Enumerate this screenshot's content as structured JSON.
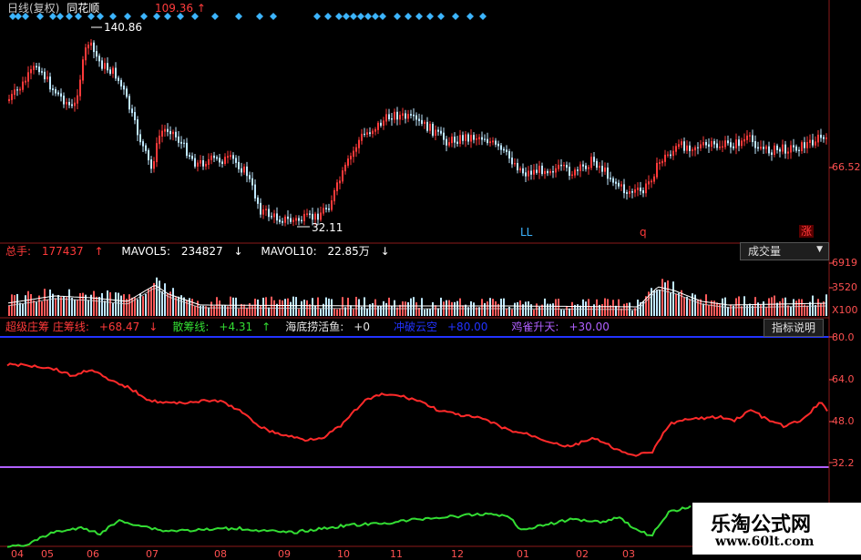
{
  "header": {
    "title": "日线(复权)",
    "stock_name": "同花顺",
    "price_marker": "109.36",
    "price_arrow": "↑"
  },
  "price_chart": {
    "high_label": "140.86",
    "low_label": "32.11",
    "axis_price": "66.52",
    "signal_marks": [
      "LL",
      "q",
      "涨"
    ],
    "colors": {
      "up": "#ff3a3a",
      "down": "#bfe8ff",
      "marker": "#3cb4ff"
    }
  },
  "volume_panel": {
    "total_label": "总手:",
    "total_value": "177437",
    "total_arrow": "↑",
    "mavol5_label": "MAVOL5:",
    "mavol5_value": "234827",
    "mavol5_arrow": "↓",
    "mavol10_label": "MAVOL10:",
    "mavol10_value": "22.85万",
    "mavol10_arrow": "↓",
    "selector_label": "成交量",
    "axis_labels": [
      "6919",
      "3520",
      "X100"
    ]
  },
  "indicator_panel": {
    "items": [
      {
        "name": "超级庄筹 庄筹线:",
        "value": "+68.47",
        "arrow": "↓",
        "color": "#ff3a3a"
      },
      {
        "name": "散筹线:",
        "value": "+4.31",
        "arrow": "↑",
        "color": "#33dd33"
      },
      {
        "name": "海底捞活鱼:",
        "value": "+0",
        "arrow": "",
        "color": "#e6e6e6"
      },
      {
        "name": "冲破云空",
        "value": "+80.00",
        "arrow": "",
        "color": "#2233ff"
      },
      {
        "name": "鸡雀升天:",
        "value": "+30.00",
        "arrow": "",
        "color": "#b060ff"
      }
    ],
    "explain_button": "指标说明",
    "axis_labels": [
      "80.0",
      "64.0",
      "48.0",
      "32.2"
    ]
  },
  "x_axis": {
    "labels": [
      "04",
      "05",
      "06",
      "07",
      "08",
      "09",
      "10",
      "11",
      "12",
      "01",
      "02",
      "03"
    ]
  },
  "watermark": {
    "brand": "乐淘公式网",
    "url": "www.60lt.com"
  }
}
